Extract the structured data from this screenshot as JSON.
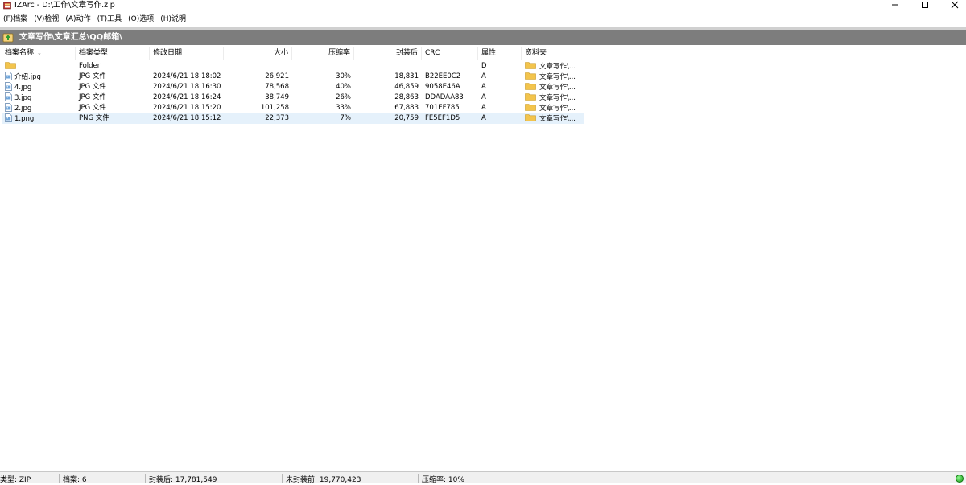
{
  "window": {
    "title": "IZArc - D:\\工作\\文章写作.zip"
  },
  "menu": [
    {
      "label": "(F)档案"
    },
    {
      "label": "(V)检视"
    },
    {
      "label": "(A)动作"
    },
    {
      "label": "(T)工具"
    },
    {
      "label": "(O)选项"
    },
    {
      "label": "(H)说明"
    }
  ],
  "path": {
    "text": "文章写作\\文章汇总\\QQ邮箱\\"
  },
  "columns": {
    "name": "档案名称",
    "type": "档案类型",
    "modified": "修改日期",
    "size": "大小",
    "ratio": "压缩率",
    "packed": "封装后",
    "crc": "CRC",
    "attr": "属性",
    "folder": "资料夹"
  },
  "files": [
    {
      "name": "",
      "type": "Folder",
      "modified": "",
      "size": "",
      "ratio": "",
      "packed": "",
      "crc": "",
      "attr": "D",
      "folder": "文章写作\\..."
    },
    {
      "name": "介绍.jpg",
      "type": "JPG 文件",
      "modified": "2024/6/21 18:18:02",
      "size": "26,921",
      "ratio": "30%",
      "packed": "18,831",
      "crc": "B22EE0C2",
      "attr": "A",
      "folder": "文章写作\\..."
    },
    {
      "name": "4.jpg",
      "type": "JPG 文件",
      "modified": "2024/6/21 18:16:30",
      "size": "78,568",
      "ratio": "40%",
      "packed": "46,859",
      "crc": "9058E46A",
      "attr": "A",
      "folder": "文章写作\\..."
    },
    {
      "name": "3.jpg",
      "type": "JPG 文件",
      "modified": "2024/6/21 18:16:24",
      "size": "38,749",
      "ratio": "26%",
      "packed": "28,863",
      "crc": "DDADAA83",
      "attr": "A",
      "folder": "文章写作\\..."
    },
    {
      "name": "2.jpg",
      "type": "JPG 文件",
      "modified": "2024/6/21 18:15:20",
      "size": "101,258",
      "ratio": "33%",
      "packed": "67,883",
      "crc": "701EF785",
      "attr": "A",
      "folder": "文章写作\\..."
    },
    {
      "name": "1.png",
      "type": "PNG 文件",
      "modified": "2024/6/21 18:15:12",
      "size": "22,373",
      "ratio": "7%",
      "packed": "20,759",
      "crc": "FE5EF1D5",
      "attr": "A",
      "folder": "文章写作\\..."
    }
  ],
  "status": {
    "type": "类型: ZIP",
    "files": "档案: 6",
    "packed": "封装后: 17,781,549",
    "unpacked": "未封装前: 19,770,423",
    "ratio": "压缩率: 10%"
  },
  "colors": {
    "pathbar": "#7d7d7d",
    "selected_row": "#e5f1fb",
    "folder": "#f3c44c",
    "status_light": "#1a9c1a"
  },
  "selected_index": 5
}
